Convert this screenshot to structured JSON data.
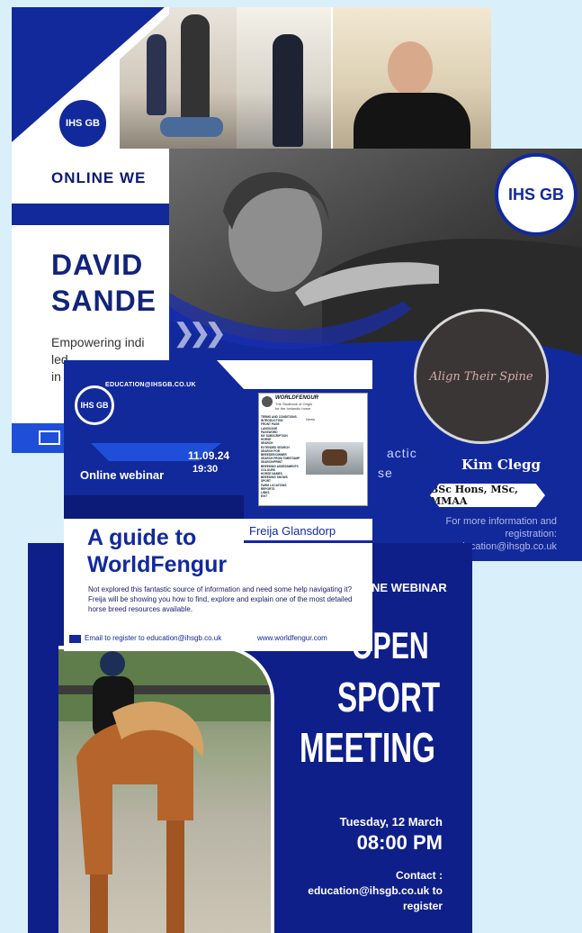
{
  "david_card": {
    "banner": "ONLINE WE",
    "name_line1": "DAVID",
    "name_line2": "SANDE",
    "tagline_line1": "Empowering indi",
    "tagline_line2": "led",
    "tagline_line3": "in"
  },
  "kim_card": {
    "logo_text": "Align Their Spine",
    "frag_line1": "actic",
    "frag_line2": "se",
    "name": "Kim Clegg",
    "credentials": "BSc Hons, MSc, MMAA",
    "info_line1": "For more information and",
    "info_line2": "registration:",
    "info_email": "ducation@ihsgb.co.uk"
  },
  "open_card": {
    "banner": "NE WEBINAR",
    "title_line1": "OPEN",
    "title_line2": "SPORT",
    "title_line3": "MEETING",
    "date": "Tuesday, 12 March",
    "time": "08:00 PM",
    "contact_label": "Contact :",
    "contact_email": "education@ihsgb.co.uk to",
    "contact_action": "register"
  },
  "wf_card": {
    "email_top": "EDUCATION@IHSGB.CO.UK",
    "date": "11.09.24",
    "time": "19:30",
    "label": "Online webinar",
    "presenter": "Freija Glansdorp",
    "title_line1": "A guide to",
    "title_line2": "WorldFengur",
    "description": "Not explored this fantastic source of information and need some help navigating it? Freija will be showing you how to find, explore and explain one of the most detailed horse breed resources available.",
    "footer_email": "Email to register to education@ihsgb.co.uk",
    "footer_url": "www.worldfengur.com",
    "screen_title": "WORLDFENGUR",
    "screen_subtitle1": "The Studbook of Origin",
    "screen_subtitle2": "for the Icelandic horse",
    "screen_news": "News",
    "screen_menu": [
      "TERMS AND CONDITIONS",
      "INTRODUCTION",
      "FRONT PAGE",
      "LANGUAGE",
      "PASSWORD",
      "MY SUBSCRIPTION",
      "HORSE",
      "SEARCH",
      "EXTENDED SEARCH",
      "SEARCH FOR BREEDER/OWNER",
      "SEARCH FROM TIMESTAMP",
      "SEARCH/PRINT",
      "BREEDING ASSESSMENTS",
      "COLOURS",
      "HORSE NAMES",
      "BREEDING SHOWS",
      "SPORT",
      "FARM LOCATIONS",
      "REPORTS",
      "LINKS",
      "EXIT"
    ]
  },
  "colors": {
    "navy": "#12299c",
    "dark_navy": "#0f1f8a",
    "sky": "#d9f0fa",
    "accent_blue": "#1f4fd8"
  }
}
